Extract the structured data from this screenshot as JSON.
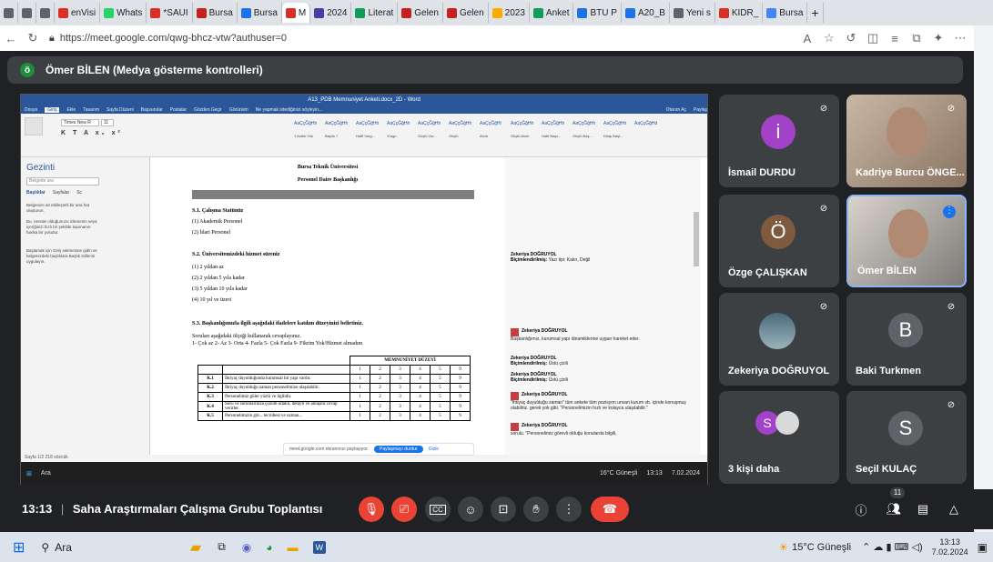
{
  "browser": {
    "tabs": [
      {
        "label": "",
        "color": "#5f6368"
      },
      {
        "label": "",
        "color": "#5f6368"
      },
      {
        "label": "",
        "color": "#5f6368"
      },
      {
        "label": "enVisi",
        "color": "#d93025"
      },
      {
        "label": "Whats",
        "color": "#25d366"
      },
      {
        "label": "*SAUI",
        "color": "#d93025"
      },
      {
        "label": "Bursa",
        "color": "#c5221f"
      },
      {
        "label": "Bursa",
        "color": "#1a73e8"
      },
      {
        "label": "M",
        "color": "#d93025"
      },
      {
        "label": "2024",
        "color": "#4b3ca5"
      },
      {
        "label": "Literat",
        "color": "#0f9d58"
      },
      {
        "label": "Gelen",
        "color": "#c5221f"
      },
      {
        "label": "Gelen",
        "color": "#c5221f"
      },
      {
        "label": "2023",
        "color": "#f9ab00"
      },
      {
        "label": "Anket",
        "color": "#0f9d58"
      },
      {
        "label": "BTU P",
        "color": "#1a73e8"
      },
      {
        "label": "A20_B",
        "color": "#1a73e8"
      },
      {
        "label": "Yeni s",
        "color": "#5f6368"
      },
      {
        "label": "KIDR_",
        "color": "#d93025"
      },
      {
        "label": "Bursa",
        "color": "#4285f4"
      }
    ],
    "new_tab": "+",
    "url": "https://meet.google.com/qwg-bhcz-vtw?authuser=0"
  },
  "presentation": {
    "avatar_letter": "ö",
    "label": "Ömer BİLEN (Medya gösterme kontrolleri)"
  },
  "word": {
    "title": "A13_PDB Memnuniyet Anketi.docx_2D - Word",
    "menu": [
      "Dosya",
      "Giriş",
      "Ekle",
      "Tasarım",
      "Sayfa Düzeni",
      "Başvurular",
      "Postalar",
      "Gözden Geçir",
      "Görünüm",
      "Ne yapmak istediğinizi söyleyin..."
    ],
    "user": "Otarım Aç",
    "share": "Paylaş",
    "font_name": "Times New R",
    "font_size": "11",
    "styles": [
      "AaÇçĞğHh",
      "AaÇçĞğHh",
      "AaÇçĞğHh",
      "AaÇçĞğHh",
      "AaÇçĞğHh",
      "AaÇçĞğHh",
      "AaÇçĞğHl",
      "AaÇçĞğHh",
      "AaÇçĞğHh",
      "AaÇçĞğHh",
      "AaÇçĞğHh",
      "AaÇçĞğHd"
    ],
    "style_names": [
      "1 Aralık Yok",
      "Başlık 7",
      "Hafif Vurg...",
      "Vurgu",
      "Güçlü Vur...",
      "Güçlü",
      "Alıntı",
      "Güçlü Alıntı",
      "Hafif Başv...",
      "Güçlü Baş...",
      "Kitap Başl..."
    ],
    "nav": {
      "title": "Gezinti",
      "search_placeholder": "Belgede ara",
      "tabs": [
        "Başlıklar",
        "Sayfalar",
        "Sc"
      ],
      "text1": "Belgenize ait etkileşimli bir ana hat oluşturun.",
      "text2": "Bu, nerede olduğunuzu izlemenin veya içeriğinizi hızlı bir şekilde taşımanın harika bir yoludur.",
      "text3": "Başlamak için Giriş sekmesine gidin ve belgenizdeki başlıklara Başlık stillerini uygulayın."
    },
    "doc": {
      "h1": "Bursa Teknik Üniversitesi",
      "h2": "Personel Daire Başkanlığı",
      "s1": "S.1. Çalışma Statünüz",
      "s1a": "(1) Akademik Personel",
      "s1b": "(2) İdari Personel",
      "s2": "S.2. Üniversitemizdeki hizmet süreniz",
      "s2a": "(1) 2 yıldan az",
      "s2b": "(2) 2 yıldan 5 yıla kadar",
      "s2c": "(3) 5 yıldan 10 yıla kadar",
      "s2d": "(4) 10 yıl ve üzeri",
      "s3": "S.3. Başkanlığımızla ilgili aşağıdaki ifadelere katılım düzeyinizi belirtiniz.",
      "s3a": "Soruları aşağıdaki ölçeği kullanarak cevaplayınız.",
      "s3b": "1- Çok az  2- Az  3- Orta  4- Fazla  5- Çok Fazla  9- Fikrim Yok/Hizmet almadım",
      "table_header": "MEMNUNİYET DÜZEYİ",
      "cols": [
        "1",
        "2",
        "3",
        "4",
        "5",
        "9"
      ],
      "rows": [
        {
          "code": "K.1",
          "text": "İhtiyaç duyulduğunda kurumsal bir yapı vardır."
        },
        {
          "code": "K.2",
          "text": "İhtiyaç duyulduğu zaman personelimize ulaşılabilir."
        },
        {
          "code": "K.3",
          "text": "Personelimiz güler yüzlü ve ilgilidir."
        },
        {
          "code": "K.4",
          "text": "Soru ve sorunlarınıza çözüm odaklı, detaylı ve anlaşılır cevap verirler."
        },
        {
          "code": "K.5",
          "text": "Personelimizin gör... tecrübesi ve uzman..."
        }
      ]
    },
    "comments": [
      {
        "author": "Zekeriya DOĞRUYOL",
        "label": "Biçimlendirilmiş:",
        "body": "Yazı tipi: Kalın, Değil"
      },
      {
        "author": "Zekeriya DOĞRUYOL",
        "label": "",
        "body": "Başkanlığımız, kurumsal yapı dinamiklerine uygun hareket eder."
      },
      {
        "author": "Zekeriya DOĞRUYOL",
        "label": "Biçimlendirilmiş:",
        "body": "Üstü çizili"
      },
      {
        "author": "Zekeriya DOĞRUYOL",
        "label": "Biçimlendirilmiş:",
        "body": "Üstü çizili"
      },
      {
        "author": "Zekeriya DOĞRUYOL",
        "label": "",
        "body": "\"İhtiyaç duyulduğu zaman\" tüm ankete tüm pozisyon unvan kurum vb. içinde konuşmuş olabiliriz. gerek yok gibi. \"Personelimizin hızlı ve kolayca ulaşılabilir.\""
      },
      {
        "author": "Zekeriya DOĞRUYOL",
        "label": "",
        "body": "sorulu. \"Personelimiz görevli olduğu konularda bilgili,"
      }
    ],
    "status": "Sayfa 1/2  218 sözcük",
    "share_banner": "meet.google.com ekranınızı paylaşıyor.",
    "share_stop": "Paylaşmayı durdur",
    "share_hide": "Gizle",
    "inner_taskbar": {
      "search": "Ara",
      "weather": "16°C Güneşli",
      "time": "13:13",
      "date": "7.02.2024"
    }
  },
  "participants": [
    {
      "name": "İsmail DURDU",
      "letter": "i",
      "color": "#a142c8",
      "type": "avatar",
      "muted": true
    },
    {
      "name": "Kadriye Burcu ÖNGE...",
      "type": "video",
      "muted": true
    },
    {
      "name": "Özge ÇALIŞKAN",
      "letter": "Ö",
      "color": "#7f5a3f",
      "type": "avatar",
      "muted": true
    },
    {
      "name": "Ömer BİLEN",
      "type": "video",
      "muted": false,
      "speaking": true
    },
    {
      "name": "Zekeriya DOĞRUYOL",
      "type": "photo",
      "muted": true
    },
    {
      "name": "Baki Turkmen",
      "letter": "B",
      "color": "#5f6368",
      "type": "avatar",
      "muted": true
    },
    {
      "name": "3 kişi daha",
      "letter": "S",
      "color": "#a142c8",
      "type": "group",
      "muted": false
    },
    {
      "name": "Seçil KULAÇ",
      "letter": "S",
      "color": "#5f6368",
      "type": "avatar",
      "muted": true
    }
  ],
  "meeting": {
    "time": "13:13",
    "separator": "|",
    "title": "Saha Araştırmaları Çalışma Grubu Toplantısı",
    "participant_count": "11",
    "captions_label": "CC"
  },
  "taskbar": {
    "search": "Ara",
    "weather": "15°C Güneşli",
    "time": "13:13",
    "date": "7.02.2024"
  }
}
